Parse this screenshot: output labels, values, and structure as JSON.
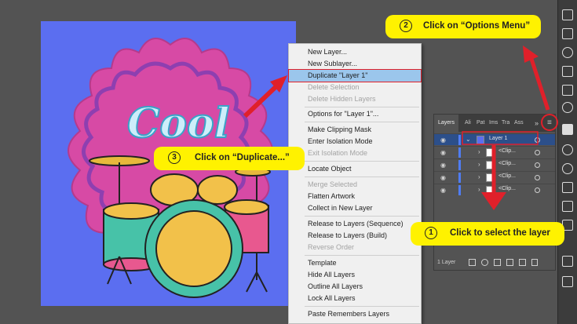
{
  "context_menu": {
    "items": [
      {
        "label": "New Layer...",
        "disabled": false
      },
      {
        "label": "New Sublayer...",
        "disabled": false
      },
      {
        "label": "Duplicate \"Layer 1\"",
        "disabled": false,
        "highlight": true
      },
      {
        "label": "Delete Selection",
        "disabled": true
      },
      {
        "label": "Delete Hidden Layers",
        "disabled": true
      },
      {
        "label": "Options for \"Layer 1\"...",
        "disabled": false
      },
      {
        "label": "Make Clipping Mask",
        "disabled": false
      },
      {
        "label": "Enter Isolation Mode",
        "disabled": false
      },
      {
        "label": "Exit Isolation Mode",
        "disabled": true
      },
      {
        "label": "Locate Object",
        "disabled": false
      },
      {
        "label": "Merge Selected",
        "disabled": true
      },
      {
        "label": "Flatten Artwork",
        "disabled": false
      },
      {
        "label": "Collect in New Layer",
        "disabled": false
      },
      {
        "label": "Release to Layers (Sequence)",
        "disabled": false
      },
      {
        "label": "Release to Layers (Build)",
        "disabled": false
      },
      {
        "label": "Reverse Order",
        "disabled": true
      },
      {
        "label": "Template",
        "disabled": false
      },
      {
        "label": "Hide All Layers",
        "disabled": false
      },
      {
        "label": "Outline All Layers",
        "disabled": false
      },
      {
        "label": "Lock All Layers",
        "disabled": false
      },
      {
        "label": "Paste Remembers Layers",
        "disabled": false
      }
    ]
  },
  "layers_panel": {
    "tabs": [
      "Layers",
      "Ali",
      "Pat",
      "Ims",
      "Tra",
      "Ass"
    ],
    "overflow_glyph": "»",
    "menu_glyph": "≡",
    "layer_name": "Layer 1",
    "sublayers": [
      "<Clip...",
      "<Clip...",
      "<Clip...",
      "<Clip..."
    ],
    "footer_count": "1 Layer"
  },
  "artwork": {
    "word": "Cool"
  },
  "annotations": {
    "step1": {
      "num": "①",
      "text": "Click to select the layer"
    },
    "step2": {
      "num": "②",
      "text": "Click on “Options Menu”"
    },
    "step3": {
      "num": "③",
      "text": "Click on “Duplicate...”"
    }
  },
  "colors": {
    "canvas_bg": "#535353",
    "artboard": "#5b6ef0",
    "badge_pink": "#d74aa5",
    "badge_wavy": "#8e3fb0",
    "callout_yellow": "#fff200",
    "arrow_red": "#e0202a",
    "menu_highlight": "#9bc6ec",
    "selected_layer": "#2c4f8a"
  }
}
